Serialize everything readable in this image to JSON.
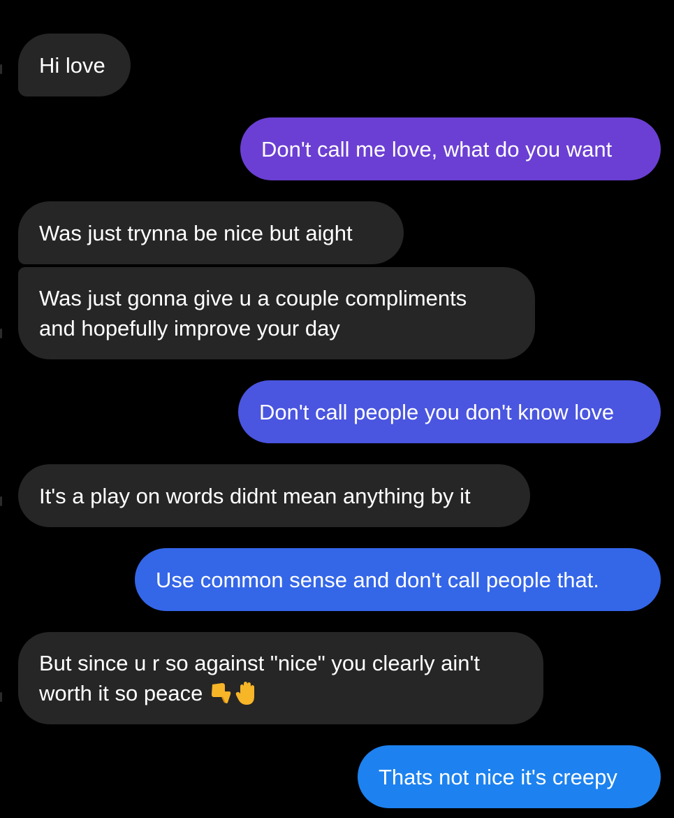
{
  "conversation": {
    "messages": [
      {
        "sender": "them",
        "text": "Hi love"
      },
      {
        "sender": "me",
        "text": "Don't call me love, what do you want",
        "color": "#6b3fd3"
      },
      {
        "sender": "them",
        "text": "Was just trynna be nice but aight"
      },
      {
        "sender": "them",
        "line1": "Was just gonna give u a couple compliments",
        "line2": "and hopefully improve your day"
      },
      {
        "sender": "me",
        "text": "Don't call people you don't know love",
        "color": "#4a55e0"
      },
      {
        "sender": "them",
        "text": "It's a play on words didnt mean anything by it"
      },
      {
        "sender": "me",
        "text": "Use common sense and don't call people that.",
        "color": "#3466e8"
      },
      {
        "sender": "them",
        "line1": "But since u r so against \"nice\" you clearly ain't",
        "line2": "worth it so peace",
        "emojis": [
          "thumbs-down-icon",
          "raised-hand-icon"
        ]
      },
      {
        "sender": "me",
        "text": "Thats not nice it's creepy",
        "color": "#1d82ef"
      }
    ]
  }
}
